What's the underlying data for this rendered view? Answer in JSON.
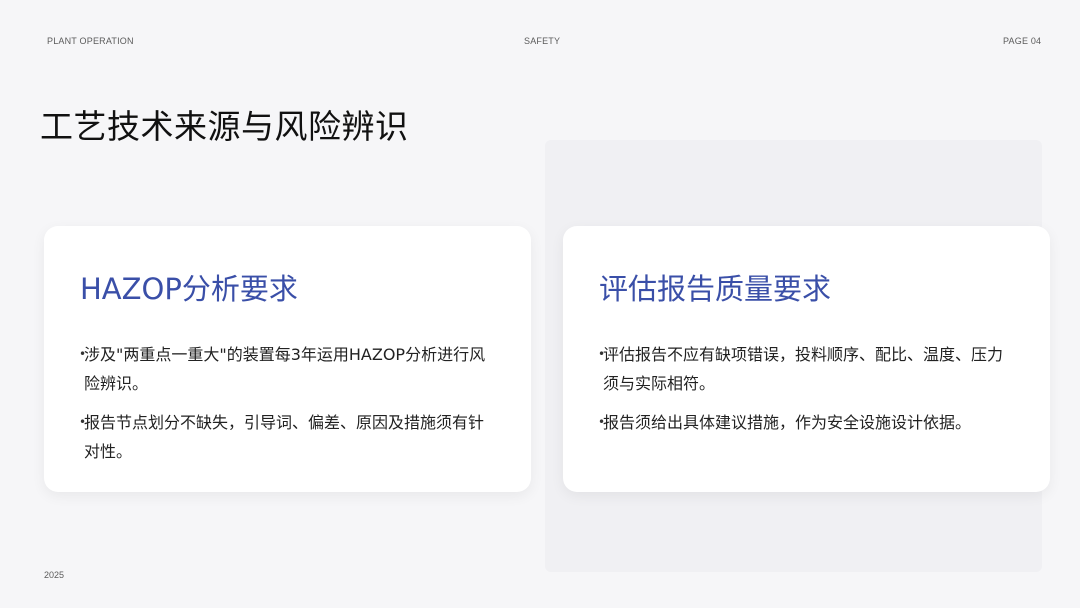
{
  "header": {
    "left": "PLANT OPERATION",
    "center": "SAFETY",
    "right": "PAGE 04"
  },
  "title": "工艺技术来源与风险辨识",
  "cards": [
    {
      "title": "HAZOP分析要求",
      "items": [
        "涉及\"两重点一重大\"的装置每3年运用HAZOP分析进行风险辨识。",
        "报告节点划分不缺失，引导词、偏差、原因及措施须有针对性。"
      ]
    },
    {
      "title": "评估报告质量要求",
      "items": [
        "评估报告不应有缺项错误，投料顺序、配比、温度、压力须与实际相符。",
        "报告须给出具体建议措施，作为安全设施设计依据。"
      ]
    }
  ],
  "footer": {
    "year": "2025"
  },
  "bullet_glyph": "•",
  "colors": {
    "background": "#f6f6f8",
    "card": "#ffffff",
    "accent": "#3a4fa8",
    "text": "#222222"
  }
}
